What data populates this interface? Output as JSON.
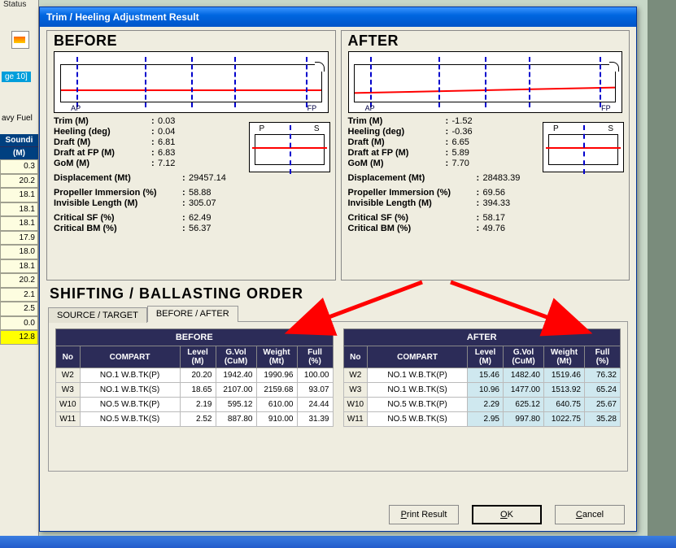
{
  "window": {
    "title": "Trim / Heeling Adjustment Result"
  },
  "status_label": "Status",
  "tab_ge10": "ge 10]",
  "avy_fuel": "avy Fuel",
  "sounding_col": {
    "hdr1": "Soundi",
    "hdr2": "(M)",
    "cells": [
      "0.3",
      "20.2",
      "18.1",
      "18.1",
      "18.1",
      "17.9",
      "18.0",
      "18.1",
      "20.2",
      "2.1",
      "2.5",
      "0.0"
    ],
    "yellow": "12.8"
  },
  "before": {
    "heading": "BEFORE",
    "hull_labels": {
      "ap": "AP",
      "fp": "FP"
    },
    "ps": {
      "p": "P",
      "s": "S"
    },
    "stats": {
      "trim_label": "Trim  (M)",
      "trim": "0.03",
      "heel_label": "Heeling (deg)",
      "heel": "0.04",
      "draft_label": "Draft (M)",
      "draft": "6.81",
      "draftfp_label": "Draft at FP  (M)",
      "draftfp": "6.83",
      "gom_label": "GoM  (M)",
      "gom": "7.12",
      "disp_label": "Displacement (Mt)",
      "disp": "29457.14",
      "prop_label": "Propeller Immersion (%)",
      "prop": "58.88",
      "inv_label": "Invisible Length  (M)",
      "inv": "305.07",
      "sf_label": "Critical SF (%)",
      "sf": "62.49",
      "bm_label": "Critical BM (%)",
      "bm": "56.37"
    }
  },
  "after": {
    "heading": "AFTER",
    "hull_labels": {
      "ap": "AP",
      "fp": "FP"
    },
    "ps": {
      "p": "P",
      "s": "S"
    },
    "stats": {
      "trim_label": "Trim  (M)",
      "trim": "-1.52",
      "heel_label": "Heeling (deg)",
      "heel": "-0.36",
      "draft_label": "Draft (M)",
      "draft": "6.65",
      "draftfp_label": "Draft at FP  (M)",
      "draftfp": "5.89",
      "gom_label": "GoM  (M)",
      "gom": "7.70",
      "disp_label": "Displacement (Mt)",
      "disp": "28483.39",
      "prop_label": "Propeller Immersion (%)",
      "prop": "69.56",
      "inv_label": "Invisible Length  (M)",
      "inv": "394.33",
      "sf_label": "Critical SF (%)",
      "sf": "58.17",
      "bm_label": "Critical BM (%)",
      "bm": "49.76"
    }
  },
  "section_shift": "SHIFTING / BALLASTING ORDER",
  "tabs": {
    "src": "SOURCE / TARGET",
    "ba": "BEFORE / AFTER"
  },
  "table_before": {
    "title": "BEFORE",
    "headers": {
      "no": "No",
      "compart": "COMPART",
      "level": "Level\n(M)",
      "gvol": "G.Vol\n(CuM)",
      "weight": "Weight\n(Mt)",
      "full": "Full\n(%)"
    },
    "rows": [
      {
        "no": "W2",
        "comp": "NO.1 W.B.TK(P)",
        "level": "20.20",
        "gvol": "1942.40",
        "weight": "1990.96",
        "full": "100.00"
      },
      {
        "no": "W3",
        "comp": "NO.1 W.B.TK(S)",
        "level": "18.65",
        "gvol": "2107.00",
        "weight": "2159.68",
        "full": "93.07"
      },
      {
        "no": "W10",
        "comp": "NO.5 W.B.TK(P)",
        "level": "2.19",
        "gvol": "595.12",
        "weight": "610.00",
        "full": "24.44"
      },
      {
        "no": "W11",
        "comp": "NO.5 W.B.TK(S)",
        "level": "2.52",
        "gvol": "887.80",
        "weight": "910.00",
        "full": "31.39"
      }
    ]
  },
  "table_after": {
    "title": "AFTER",
    "headers": {
      "no": "No",
      "compart": "COMPART",
      "level": "Level\n(M)",
      "gvol": "G.Vol\n(CuM)",
      "weight": "Weight\n(Mt)",
      "full": "Full\n(%)"
    },
    "rows": [
      {
        "no": "W2",
        "comp": "NO.1 W.B.TK(P)",
        "level": "15.46",
        "gvol": "1482.40",
        "weight": "1519.46",
        "full": "76.32",
        "hl": true
      },
      {
        "no": "W3",
        "comp": "NO.1 W.B.TK(S)",
        "level": "10.96",
        "gvol": "1477.00",
        "weight": "1513.92",
        "full": "65.24",
        "hl": true
      },
      {
        "no": "W10",
        "comp": "NO.5 W.B.TK(P)",
        "level": "2.29",
        "gvol": "625.12",
        "weight": "640.75",
        "full": "25.67",
        "hl": true
      },
      {
        "no": "W11",
        "comp": "NO.5 W.B.TK(S)",
        "level": "2.95",
        "gvol": "997.80",
        "weight": "1022.75",
        "full": "35.28",
        "hl": true
      }
    ]
  },
  "buttons": {
    "print": "Print Result",
    "ok": "OK",
    "cancel": "Cancel",
    "ok_u": "O",
    "cancel_u": "C",
    "print_u": "P"
  }
}
